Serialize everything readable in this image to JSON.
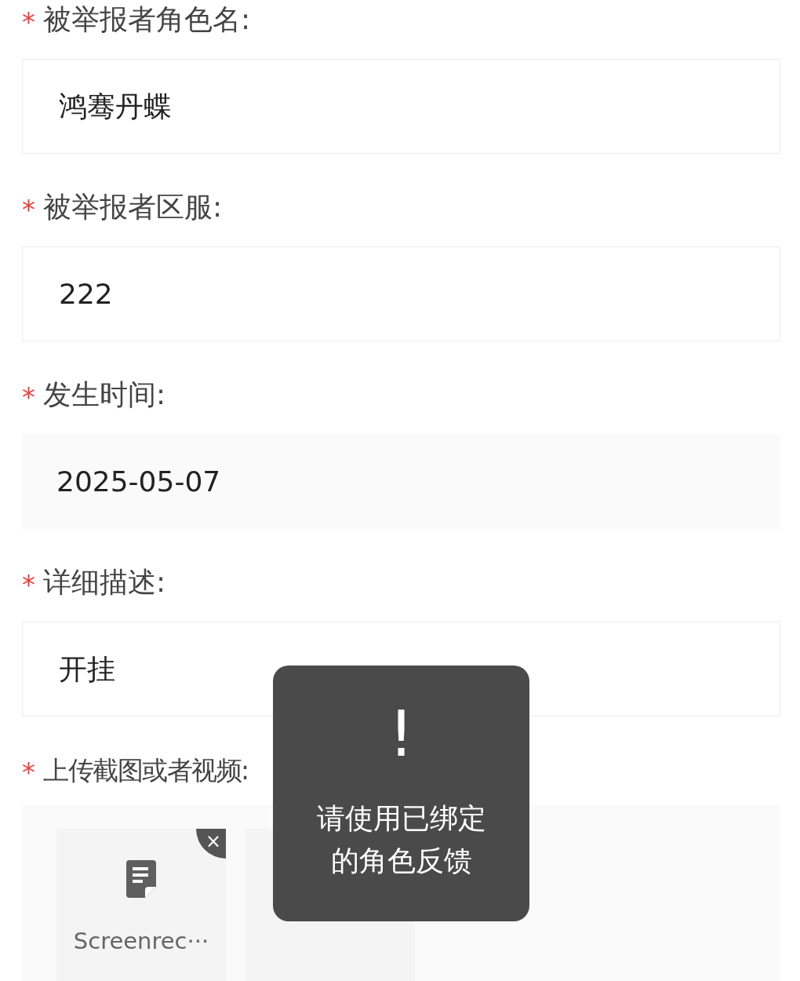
{
  "fields": [
    {
      "label": "被举报者角色名:",
      "required_mark": "*",
      "kind": "input",
      "value": "鸿骞丹蝶"
    },
    {
      "label": "被举报者区服:",
      "required_mark": "*",
      "kind": "input",
      "value": "222"
    },
    {
      "label": "发生时间:",
      "required_mark": "*",
      "kind": "date",
      "value": "2025-05-07"
    },
    {
      "label": "详细描述:",
      "required_mark": "*",
      "kind": "input",
      "value": "开挂"
    }
  ],
  "upload": {
    "label": "上传截图或者视频:",
    "required_mark": "*",
    "files": [
      {
        "name": "Screenrec···",
        "remove": "×"
      }
    ]
  },
  "toast": {
    "icon": "!",
    "message": [
      "请使用已绑定",
      "的角色反馈"
    ]
  }
}
